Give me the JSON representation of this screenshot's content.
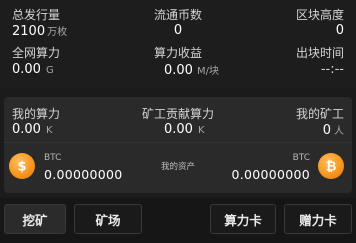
{
  "stats": {
    "total_issued": {
      "label": "总发行量",
      "value": "2100",
      "unit": "万枚"
    },
    "circulating": {
      "label": "流通币数",
      "value": "0"
    },
    "block_height": {
      "label": "区块高度",
      "value": "0"
    },
    "network_hashrate": {
      "label": "全网算力",
      "value": "0.00",
      "unit": "G"
    },
    "hashrate_income": {
      "label": "算力收益",
      "value": "0.00",
      "unit": "M/块"
    },
    "block_time": {
      "label": "出块时间",
      "value": "--:--"
    }
  },
  "mining": {
    "my_hashrate": {
      "label": "我的算力",
      "value": "0.00",
      "unit": "K"
    },
    "contrib_hashrate": {
      "label": "矿工贡献算力",
      "value": "0.00",
      "unit": "K"
    },
    "my_miners": {
      "label": "我的矿工",
      "value": "0",
      "unit": "人"
    }
  },
  "assets": {
    "label": "我的资产",
    "left": {
      "currency": "BTC",
      "value": "0.00000000",
      "icon": "bitcoin-icon"
    },
    "right": {
      "currency": "BTC",
      "value": "0.00000000",
      "icon": "bitcoin-icon"
    }
  },
  "tabs": {
    "mine": "挖矿",
    "farm": "矿场",
    "hashrate_card": "算力卡",
    "gift_card": "赠力卡"
  },
  "colors": {
    "background": "#1b1b1b",
    "panel": "#2a2a2a",
    "coin": "#f7931a"
  }
}
